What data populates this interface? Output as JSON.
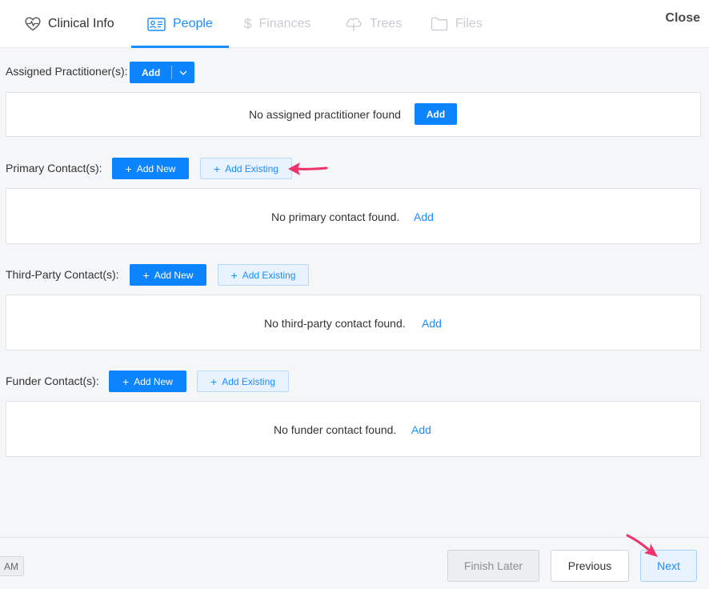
{
  "tabs": [
    {
      "label": "Clinical Info",
      "icon": "heart-pulse-icon",
      "state": "normal"
    },
    {
      "label": "People",
      "icon": "contact-card-icon",
      "state": "active"
    },
    {
      "label": "Finances",
      "icon": "dollar-icon",
      "state": "disabled"
    },
    {
      "label": "Trees",
      "icon": "tree-icon",
      "state": "disabled"
    },
    {
      "label": "Files",
      "icon": "folder-icon",
      "state": "disabled"
    }
  ],
  "close_label": "Close",
  "sections": {
    "practitioner": {
      "label": "Assigned Practitioner(s):",
      "add_label": "Add",
      "empty_text": "No assigned practitioner found",
      "empty_add_label": "Add"
    },
    "primary": {
      "label": "Primary Contact(s):",
      "add_new_label": "Add New",
      "add_existing_label": "Add Existing",
      "empty_text": "No primary contact found.",
      "empty_add_label": "Add"
    },
    "third_party": {
      "label": "Third-Party Contact(s):",
      "add_new_label": "Add New",
      "add_existing_label": "Add Existing",
      "empty_text": "No third-party contact found.",
      "empty_add_label": "Add"
    },
    "funder": {
      "label": "Funder Contact(s):",
      "add_new_label": "Add New",
      "add_existing_label": "Add Existing",
      "empty_text": "No funder contact found.",
      "empty_add_label": "Add"
    }
  },
  "footer": {
    "am_label": "AM",
    "finish_later_label": "Finish Later",
    "previous_label": "Previous",
    "next_label": "Next"
  },
  "colors": {
    "accent": "#1a8cff",
    "primary_button": "#0d84ff",
    "annotation_arrow": "#f0336b",
    "disabled_tab": "#c8ccd1"
  }
}
